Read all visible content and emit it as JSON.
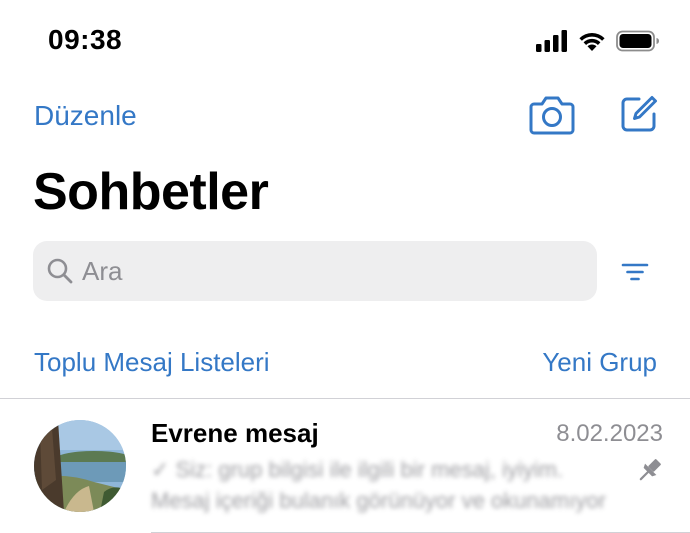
{
  "status_bar": {
    "time": "09:38"
  },
  "nav": {
    "edit_label": "Düzenle",
    "camera_icon": "camera-icon",
    "compose_icon": "compose-icon"
  },
  "page": {
    "title": "Sohbetler"
  },
  "search": {
    "placeholder": "Ara",
    "filter_icon": "filter-icon"
  },
  "links": {
    "broadcast": "Toplu Mesaj Listeleri",
    "new_group": "Yeni Grup"
  },
  "chats": [
    {
      "name": "Evrene mesaj",
      "date": "8.02.2023",
      "preview_line1": "✓ Siz: grup bilgisi ile ilgili bir mesaj, iyiyim.",
      "preview_line2": "Mesaj içeriği bulanık görünüyor ve okunamıyor ...",
      "pinned": true
    }
  ],
  "colors": {
    "accent": "#3478c6",
    "secondary_text": "#8e8e93",
    "search_bg": "#eeeeef"
  }
}
